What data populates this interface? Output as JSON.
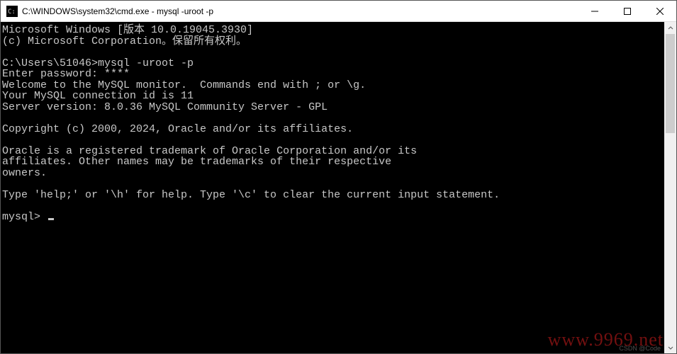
{
  "window": {
    "title": "C:\\WINDOWS\\system32\\cmd.exe - mysql  -uroot -p"
  },
  "terminal": {
    "lines": [
      "Microsoft Windows [版本 10.0.19045.3930]",
      "(c) Microsoft Corporation。保留所有权利。",
      "",
      "C:\\Users\\51046>mysql -uroot -p",
      "Enter password: ****",
      "Welcome to the MySQL monitor.  Commands end with ; or \\g.",
      "Your MySQL connection id is 11",
      "Server version: 8.0.36 MySQL Community Server - GPL",
      "",
      "Copyright (c) 2000, 2024, Oracle and/or its affiliates.",
      "",
      "Oracle is a registered trademark of Oracle Corporation and/or its",
      "affiliates. Other names may be trademarks of their respective",
      "owners.",
      "",
      "Type 'help;' or '\\h' for help. Type '\\c' to clear the current input statement.",
      ""
    ],
    "prompt": "mysql> "
  },
  "watermarks": {
    "site": "www.9969.net",
    "csdn": "CSDN @Code"
  }
}
